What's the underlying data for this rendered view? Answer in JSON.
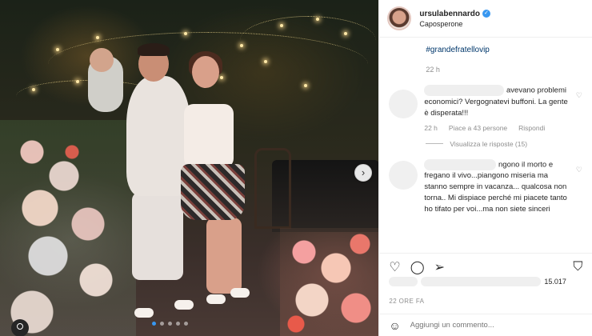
{
  "header": {
    "username": "ursulabennardo",
    "location": "Caposperone"
  },
  "caption": {
    "hashtag": "#grandefratellovip",
    "time": "22 h"
  },
  "comments": [
    {
      "text_visible": "avevano problemi economici? Vergognatevi buffoni. La gente è disperata!!!",
      "time": "22 h",
      "likes": "Piace a 43 persone",
      "reply_label": "Rispondi",
      "view_replies": "Visualizza le risposte (15)"
    },
    {
      "text_visible": "ngono il morto e fregano il vivo...piangono miseria ma stanno sempre in vacanza... qualcosa non torna.. Mi dispiace perché mi piacete tanto ho tifato per voi...ma non siete sinceri"
    }
  ],
  "likes": {
    "count_partial": "15.017"
  },
  "date": "22 ORE FA",
  "add_comment": {
    "placeholder": "Aggiungi un commento..."
  },
  "carousel": {
    "next_icon": "chevron-right-icon",
    "total_slides": 5,
    "active_slide": 0
  },
  "colors": {
    "link": "#00376b",
    "verified": "#3897f0",
    "muted": "#8e8e8e"
  }
}
